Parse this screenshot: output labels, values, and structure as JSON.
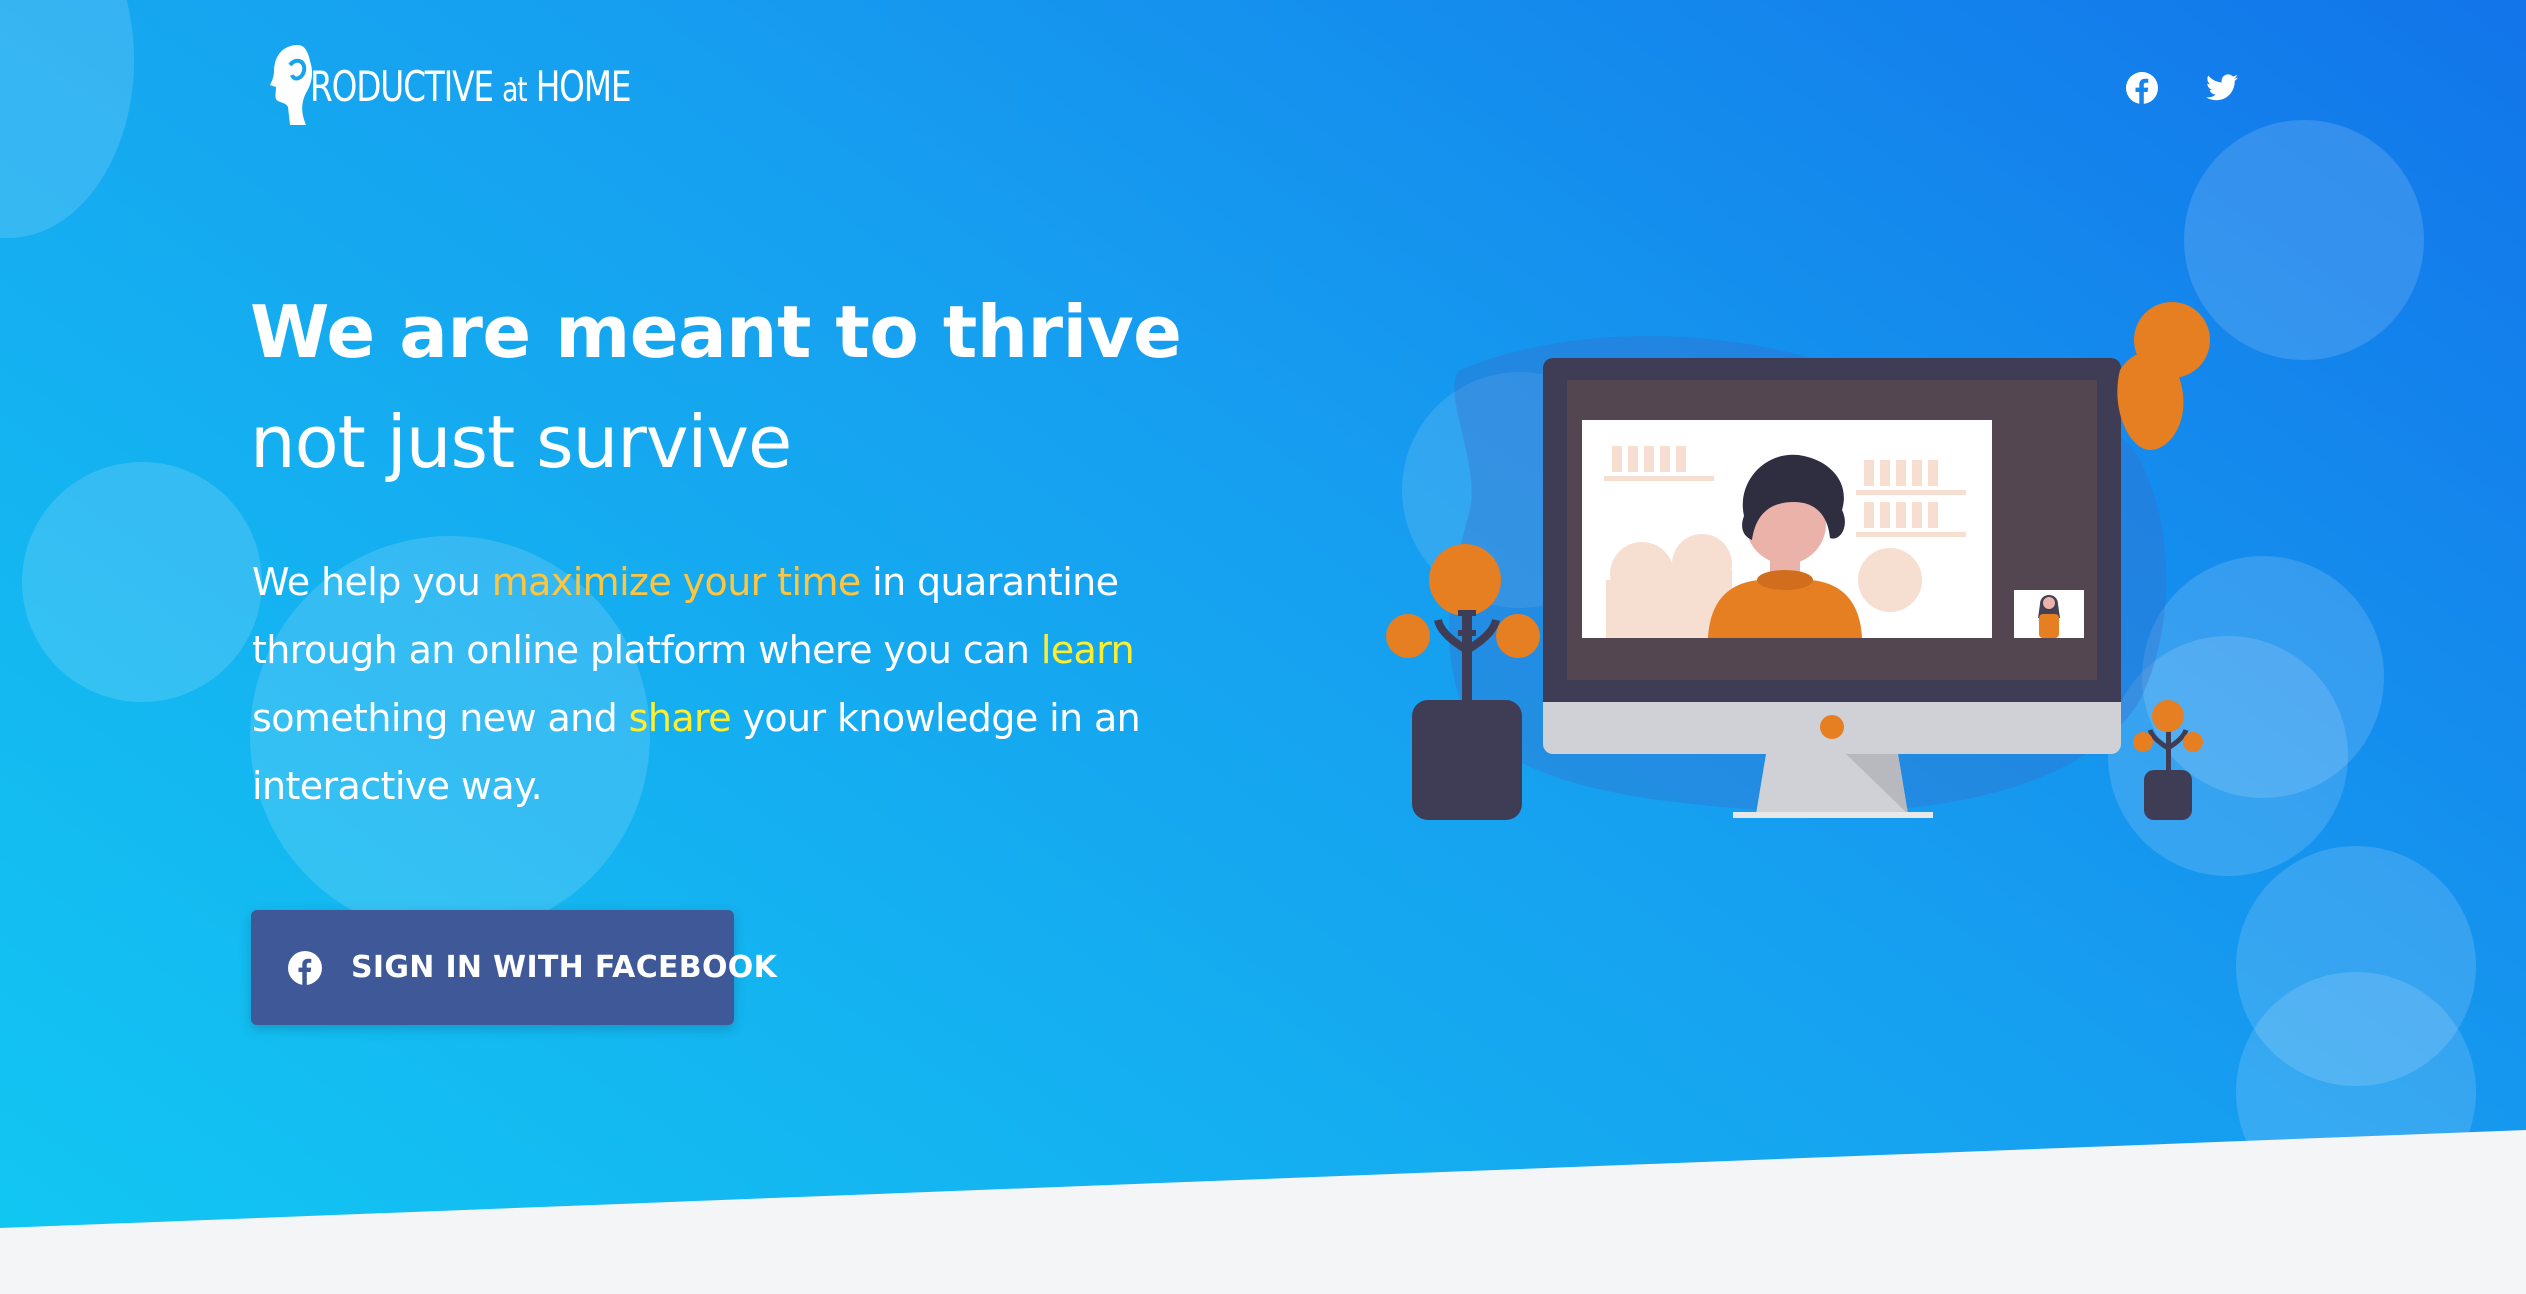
{
  "brand": {
    "logo_text_start": "RODUCTIVE",
    "logo_text_mid": "at",
    "logo_text_end": "HOME",
    "logo_icon": "head-profile-icon"
  },
  "header": {
    "social": [
      {
        "icon": "facebook-icon"
      },
      {
        "icon": "twitter-icon"
      }
    ]
  },
  "hero": {
    "title_bold": "We are meant to thrive",
    "title_light": "not just survive",
    "description": {
      "part1": "We help you ",
      "highlight1": "maximize your time",
      "part2": " in quarantine through an online platform where you can ",
      "highlight2": "learn",
      "part3": " something new and ",
      "highlight3": "share",
      "part4": " your knowledge in an interactive way."
    },
    "cta_label": "SIGN IN WITH FACEBOOK",
    "illustration": "video-call-monitor-illustration"
  },
  "colors": {
    "gradient_start": "#12c8f2",
    "gradient_end": "#1275ea",
    "facebook_button": "#3e5898",
    "highlight_orange": "#ffc53d",
    "highlight_yellow": "#ffee2e",
    "footer_bg": "#f3f5f7"
  }
}
